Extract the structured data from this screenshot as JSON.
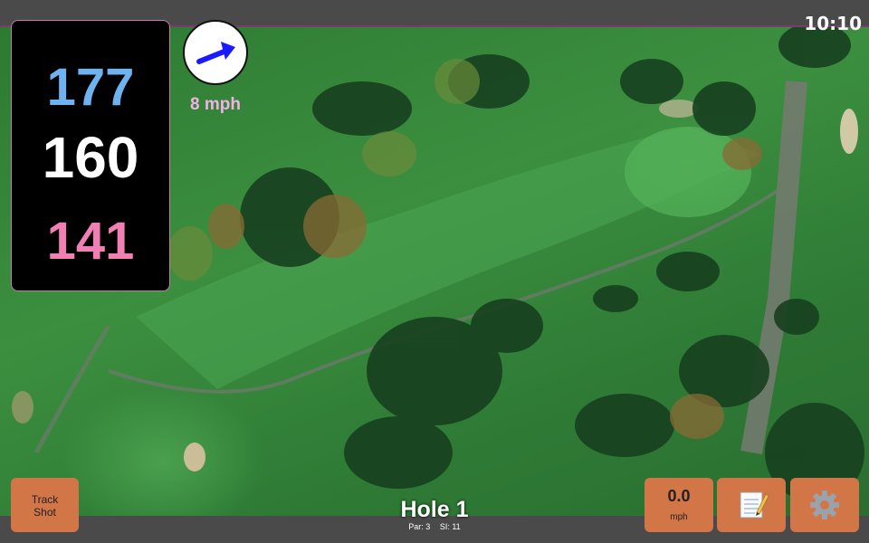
{
  "status": {
    "time": "10:10"
  },
  "distances": {
    "back": "177",
    "middle": "160",
    "front": "141"
  },
  "wind": {
    "speed": "8 mph",
    "icon": "wind-direction-arrow-icon"
  },
  "hole": {
    "title": "Hole 1",
    "par": "Par: 3",
    "si": "SI: 11"
  },
  "buttons": {
    "track_shot_line1": "Track",
    "track_shot_line2": "Shot",
    "speed_value": "0.0",
    "speed_unit": "mph",
    "notes_icon": "notepad-icon",
    "settings_icon": "gear-icon"
  },
  "colors": {
    "back_distance": "#6fb2f0",
    "middle_distance": "#ffffff",
    "front_distance": "#f07fb4",
    "button_bg": "#d27547",
    "wind_arrow": "#1a1aff"
  }
}
